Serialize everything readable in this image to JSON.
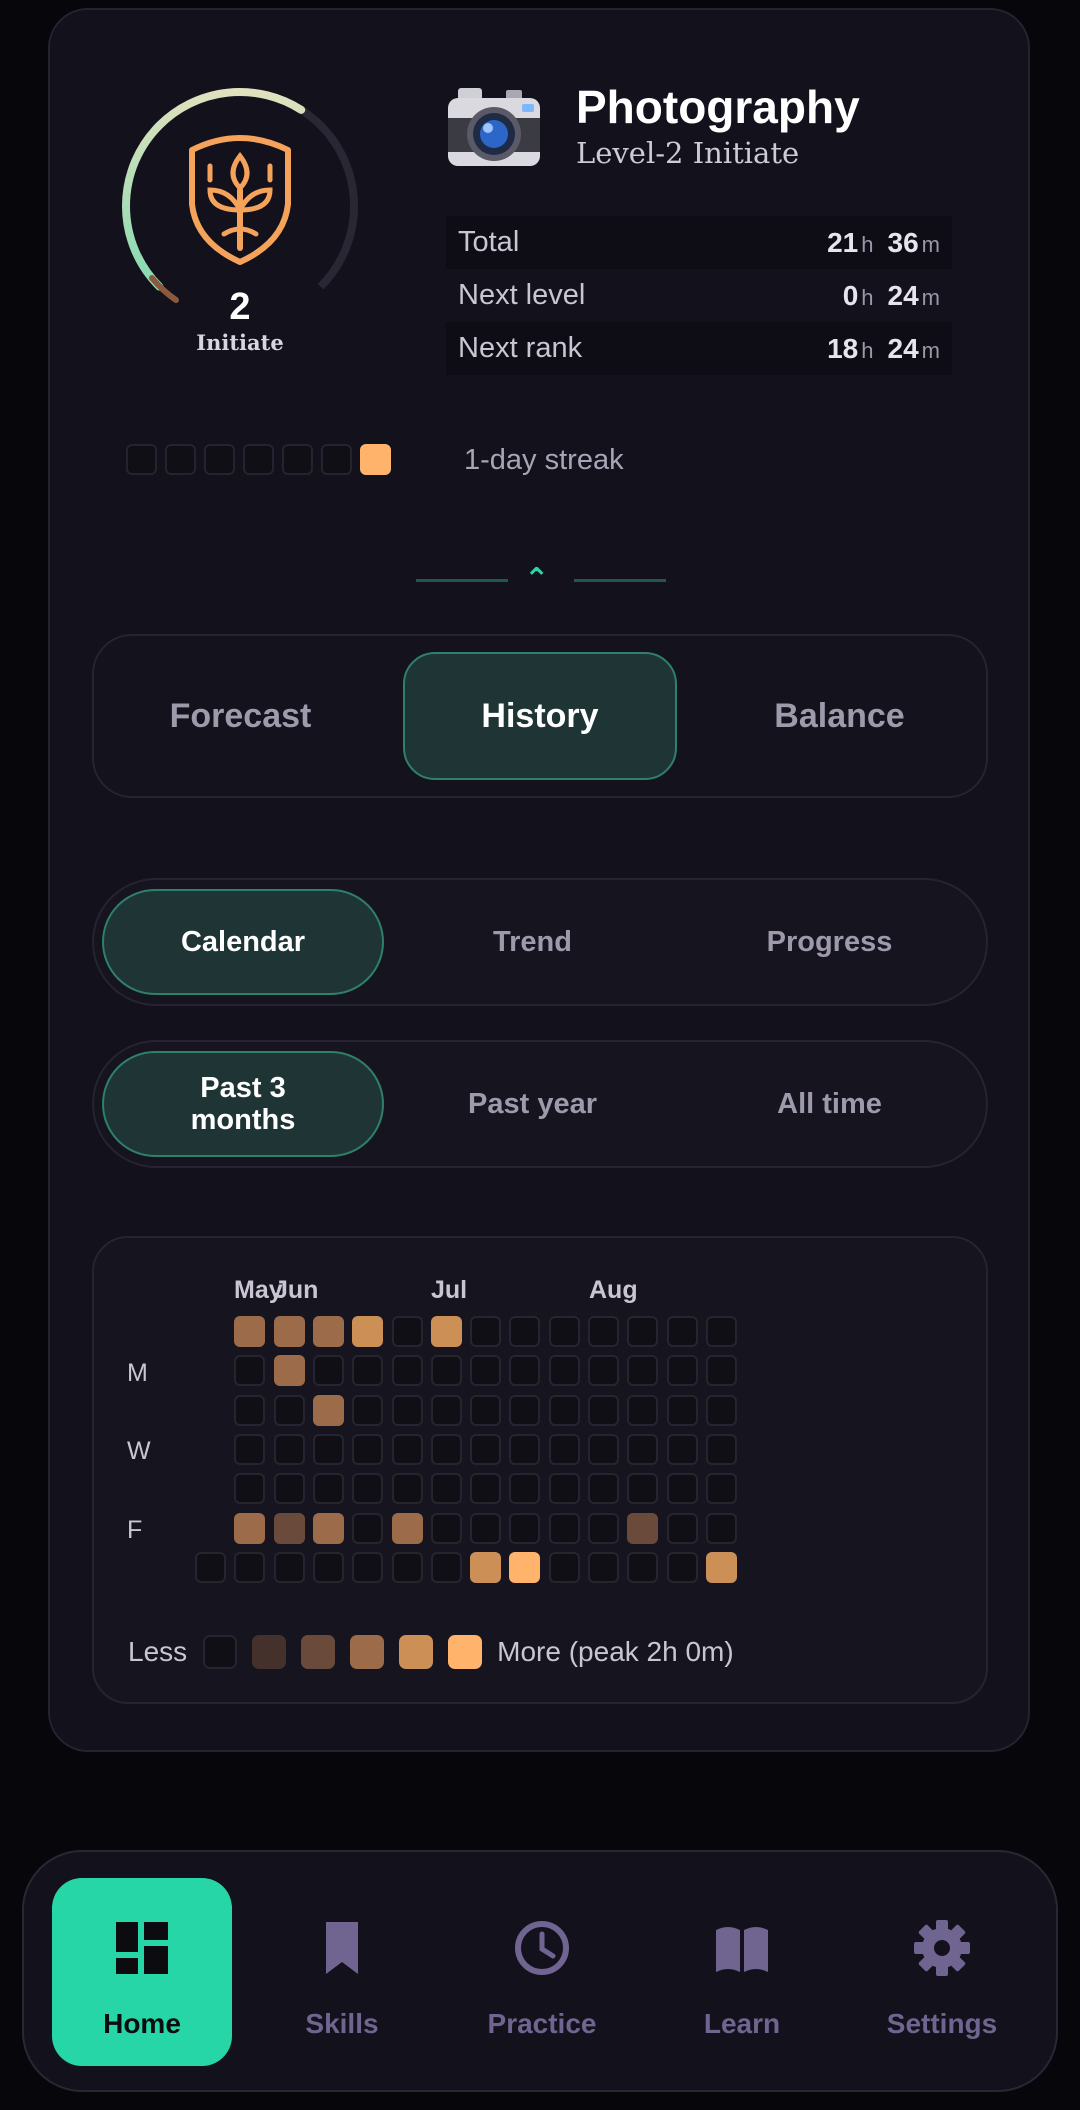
{
  "skill": {
    "title": "Photography",
    "subtitle": "Level-2 Initiate",
    "level": "2",
    "rank": "Initiate",
    "level_progress": 0.62,
    "icon": "camera-icon",
    "badge_icon": "shield-sprout-icon"
  },
  "stats": [
    {
      "label": "Total",
      "hours": "21",
      "minutes": "36"
    },
    {
      "label": "Next level",
      "hours": "0",
      "minutes": "24"
    },
    {
      "label": "Next rank",
      "hours": "18",
      "minutes": "24"
    }
  ],
  "units": {
    "h": "h",
    "m": "m"
  },
  "streak": {
    "text": "1-day streak",
    "days": [
      0,
      0,
      0,
      0,
      0,
      0,
      1
    ]
  },
  "divider_icon": "chevron-up-icon",
  "view_tabs": {
    "items": [
      "Forecast",
      "History",
      "Balance"
    ],
    "selected": "History"
  },
  "chart_tabs": {
    "items": [
      "Calendar",
      "Trend",
      "Progress"
    ],
    "selected": "Calendar"
  },
  "range_tabs": {
    "items": [
      "Past 3 months",
      "Past year",
      "All time"
    ],
    "selected": "Past 3 months"
  },
  "heatmap": {
    "months": [
      "May",
      "Jun",
      "Jul",
      "Aug"
    ],
    "day_labels": [
      "M",
      "W",
      "F"
    ],
    "legend": {
      "less": "Less",
      "more": "More (peak 2h 0m)"
    },
    "colors": [
      "#100f16",
      "#45312b",
      "#6a4a3a",
      "#9c6b4a",
      "#cc8f55",
      "#ffb36b"
    ]
  },
  "chart_data": {
    "type": "heatmap",
    "title": "",
    "xlabel": "",
    "ylabel": "",
    "x": [
      "May",
      "Jun",
      "Jul",
      "Aug"
    ],
    "y": [
      "M",
      "W",
      "F"
    ],
    "weeks": [
      [
        -1,
        -1,
        -1,
        -1,
        -1,
        -1,
        0
      ],
      [
        3,
        0,
        0,
        0,
        0,
        3,
        0
      ],
      [
        3,
        3,
        0,
        0,
        0,
        2,
        0
      ],
      [
        3,
        0,
        3,
        0,
        0,
        3,
        0
      ],
      [
        4,
        0,
        0,
        0,
        0,
        0,
        0
      ],
      [
        0,
        0,
        0,
        0,
        0,
        3,
        0
      ],
      [
        4,
        0,
        0,
        0,
        0,
        0,
        0
      ],
      [
        0,
        0,
        0,
        0,
        0,
        0,
        4
      ],
      [
        0,
        0,
        0,
        0,
        0,
        0,
        5
      ],
      [
        0,
        0,
        0,
        0,
        0,
        0,
        0
      ],
      [
        0,
        0,
        0,
        0,
        0,
        0,
        0
      ],
      [
        0,
        0,
        0,
        0,
        0,
        2,
        0
      ],
      [
        0,
        0,
        0,
        0,
        0,
        0,
        0
      ],
      [
        0,
        0,
        0,
        0,
        0,
        0,
        4
      ]
    ],
    "scale_max": "2h 0m"
  },
  "nav": [
    {
      "label": "Home",
      "icon": "dashboard-icon",
      "active": true
    },
    {
      "label": "Skills",
      "icon": "bookmark-icon",
      "active": false
    },
    {
      "label": "Practice",
      "icon": "clock-icon",
      "active": false
    },
    {
      "label": "Learn",
      "icon": "book-icon",
      "active": false
    },
    {
      "label": "Settings",
      "icon": "gear-icon",
      "active": false
    }
  ]
}
